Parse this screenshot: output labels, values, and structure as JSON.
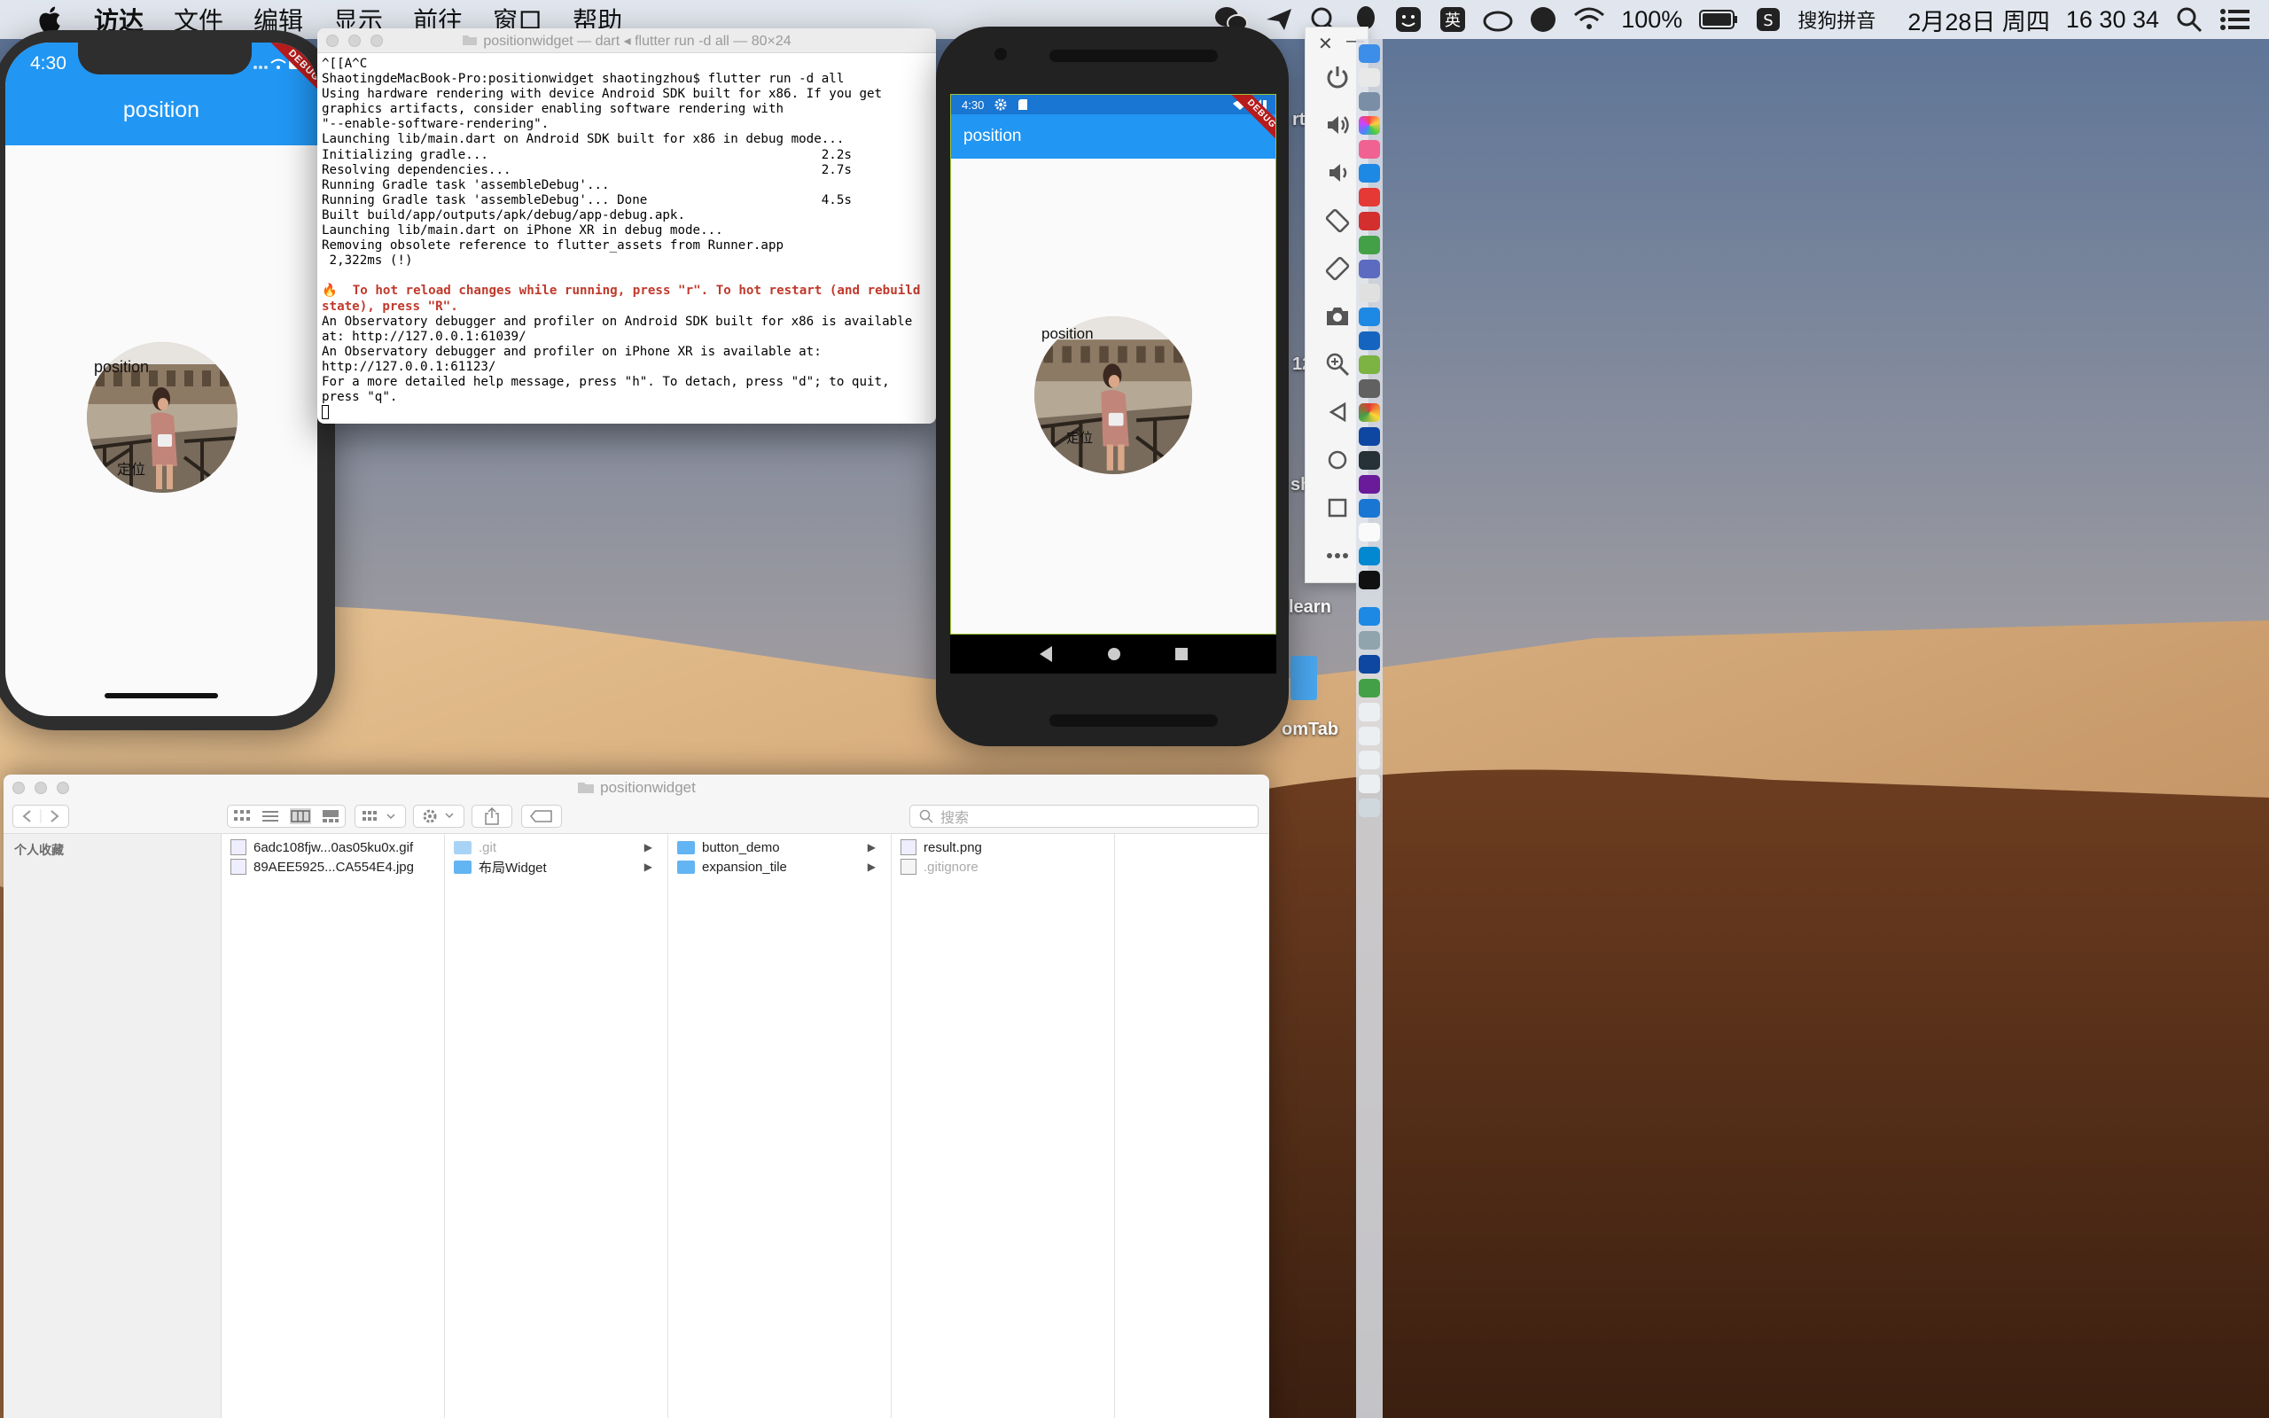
{
  "menubar": {
    "menus": [
      "访达",
      "文件",
      "编辑",
      "显示",
      "前往",
      "窗口",
      "帮助"
    ],
    "battery": "100%",
    "input_method": "搜狗拼音",
    "date": "2月28日 周四",
    "time": "16 30 34"
  },
  "iphone": {
    "time": "4:30",
    "app_title": "position",
    "photo_label": "position",
    "photo_caption": "定位",
    "debug_banner": "DEBUG"
  },
  "terminal": {
    "title": "positionwidget — dart ◂ flutter run -d all — 80×24",
    "lines": [
      "^[[A^C",
      "ShaotingdeMacBook-Pro:positionwidget shaotingzhou$ flutter run -d all",
      "Using hardware rendering with device Android SDK built for x86. If you get",
      "graphics artifacts, consider enabling software rendering with",
      "\"--enable-software-rendering\".",
      "Launching lib/main.dart on Android SDK built for x86 in debug mode...",
      "Initializing gradle...                                            2.2s",
      "Resolving dependencies...                                         2.7s",
      "Running Gradle task 'assembleDebug'...",
      "Running Gradle task 'assembleDebug'... Done                       4.5s",
      "Built build/app/outputs/apk/debug/app-debug.apk.",
      "Launching lib/main.dart on iPhone XR in debug mode...",
      "Removing obsolete reference to flutter_assets from Runner.app",
      " 2,322ms (!)",
      ""
    ],
    "hot_line_1": "🔥  To hot reload changes while running, press \"r\". To hot restart (and rebuild",
    "hot_line_2": "state), press \"R\".",
    "tail_lines": [
      "An Observatory debugger and profiler on Android SDK built for x86 is available",
      "at: http://127.0.0.1:61039/",
      "An Observatory debugger and profiler on iPhone XR is available at:",
      "http://127.0.0.1:61123/",
      "For a more detailed help message, press \"h\". To detach, press \"d\"; to quit,",
      "press \"q\"."
    ]
  },
  "android": {
    "time": "4:30",
    "app_title": "position",
    "photo_label": "position",
    "photo_caption": "定位",
    "debug_banner": "DEBUG"
  },
  "desktop": {
    "label_learn": "learn",
    "label_tab": "omTab",
    "label_sh": "sh",
    "label_rt": "rt",
    "label_12": "12"
  },
  "finder": {
    "title": "positionwidget",
    "search_placeholder": "搜索",
    "sidebar_heading": "个人收藏",
    "col1": [
      "6adc108fjw...0as05ku0x.gif",
      "89AEE5925...CA554E4.jpg"
    ],
    "col2": [
      ".git",
      "布局Widget"
    ],
    "col3": [
      "button_demo",
      "expansion_tile"
    ],
    "col4": [
      "result.png",
      ".gitignore"
    ]
  }
}
